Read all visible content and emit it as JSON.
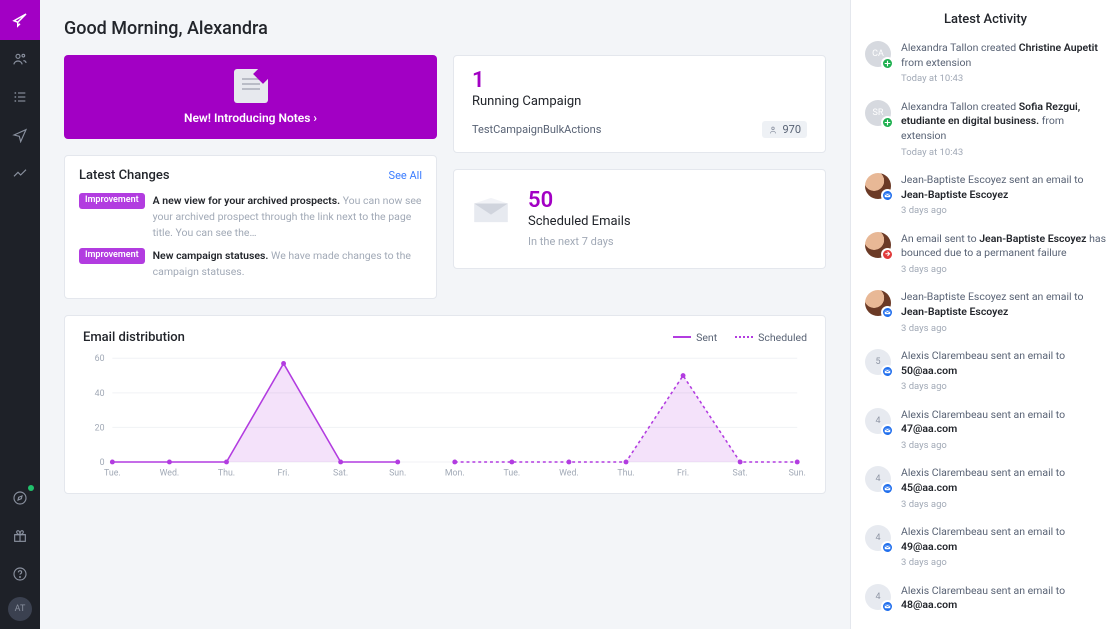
{
  "rail": {
    "logo": "feather-icon",
    "items": [
      "people-icon",
      "list-icon",
      "send-icon",
      "chart-icon"
    ],
    "bottom": [
      "compass-icon",
      "gift-icon",
      "help-icon"
    ],
    "avatar_initials": "AT"
  },
  "greeting": "Good Morning, Alexandra",
  "banner": {
    "text": "New! Introducing Notes ›"
  },
  "changes": {
    "title": "Latest Changes",
    "see_all": "See All",
    "items": [
      {
        "tag": "Improvement",
        "title": "A new view for your archived prospects.",
        "desc": "You can now see your archived prospect through the link next to the page title. You can see the…"
      },
      {
        "tag": "Improvement",
        "title": "New campaign statuses.",
        "desc": "We have made changes to the campaign statuses."
      }
    ]
  },
  "running": {
    "count": "1",
    "label": "Running Campaign",
    "rows": [
      {
        "name": "TestCampaignBulkActions",
        "value": "970"
      }
    ]
  },
  "scheduled": {
    "count": "50",
    "label": "Scheduled Emails",
    "sub": "In the next 7 days"
  },
  "chart_data": {
    "type": "line",
    "title": "Email distribution",
    "ylim": [
      0,
      60
    ],
    "yticks": [
      0,
      20,
      40,
      60
    ],
    "categories": [
      "Tue.",
      "Wed.",
      "Thu.",
      "Fri.",
      "Sat.",
      "Sun.",
      "Mon.",
      "Tue.",
      "Wed.",
      "Thu.",
      "Fri.",
      "Sat.",
      "Sun."
    ],
    "series": [
      {
        "name": "Sent",
        "style": "solid",
        "values": [
          0,
          0,
          0,
          57,
          0,
          0,
          null,
          null,
          null,
          null,
          null,
          null,
          null
        ]
      },
      {
        "name": "Scheduled",
        "style": "dashed",
        "values": [
          null,
          null,
          null,
          null,
          null,
          null,
          0,
          0,
          0,
          0,
          50,
          0,
          0
        ]
      }
    ]
  },
  "activity": {
    "title": "Latest Activity",
    "items": [
      {
        "avatar": "CA",
        "avatar_kind": "initials",
        "badge": "g",
        "html": "Alexandra Tallon created <b>Christine Aupetit</b> from extension",
        "time": "Today at 10:43"
      },
      {
        "avatar": "SR",
        "avatar_kind": "initials",
        "badge": "g",
        "html": "Alexandra Tallon created <b>Sofia Rezgui, etudiante en digital business.</b> from extension",
        "time": "Today at 10:43"
      },
      {
        "avatar": "",
        "avatar_kind": "photo",
        "badge": "b",
        "html": "Jean-Baptiste Escoyez sent an email to <b>Jean-Baptiste Escoyez</b>",
        "time": "3 days ago"
      },
      {
        "avatar": "",
        "avatar_kind": "photo",
        "badge": "r",
        "html": "An email sent to <b>Jean-Baptiste Escoyez</b> has bounced due to a permanent failure",
        "time": "3 days ago"
      },
      {
        "avatar": "",
        "avatar_kind": "photo",
        "badge": "b",
        "html": "Jean-Baptiste Escoyez sent an email to <b>Jean-Baptiste Escoyez</b>",
        "time": "3 days ago"
      },
      {
        "avatar": "5",
        "avatar_kind": "num",
        "badge": "b",
        "html": "Alexis Clarembeau sent an email to <b>50@aa.com</b>",
        "time": "3 days ago"
      },
      {
        "avatar": "4",
        "avatar_kind": "num",
        "badge": "b",
        "html": "Alexis Clarembeau sent an email to <b>47@aa.com</b>",
        "time": "3 days ago"
      },
      {
        "avatar": "4",
        "avatar_kind": "num",
        "badge": "b",
        "html": "Alexis Clarembeau sent an email to <b>45@aa.com</b>",
        "time": "3 days ago"
      },
      {
        "avatar": "4",
        "avatar_kind": "num",
        "badge": "b",
        "html": "Alexis Clarembeau sent an email to <b>49@aa.com</b>",
        "time": "3 days ago"
      },
      {
        "avatar": "4",
        "avatar_kind": "num",
        "badge": "b",
        "html": "Alexis Clarembeau sent an email to <b>48@aa.com</b>",
        "time": ""
      }
    ]
  }
}
